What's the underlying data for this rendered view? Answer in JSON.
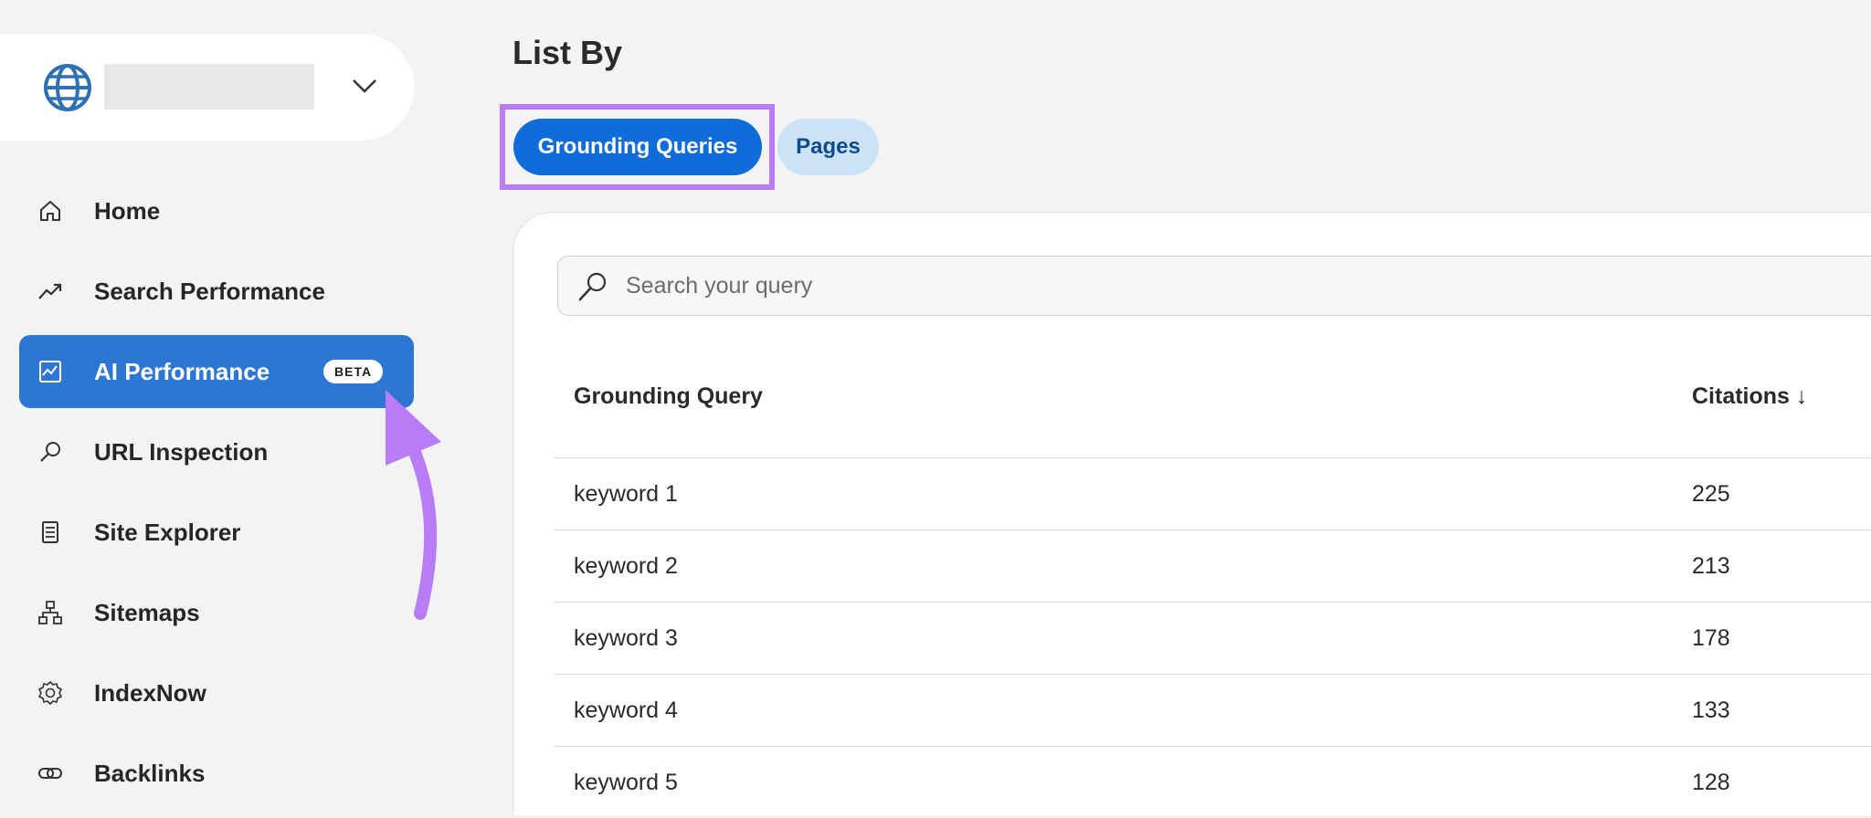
{
  "sidebar": {
    "nav_items": [
      {
        "label": "Home",
        "icon": "home-icon"
      },
      {
        "label": "Search Performance",
        "icon": "trending-up-icon"
      },
      {
        "label": "AI Performance",
        "icon": "chart-icon",
        "badge": "BETA",
        "active": true
      },
      {
        "label": "URL Inspection",
        "icon": "search-icon"
      },
      {
        "label": "Site Explorer",
        "icon": "document-list-icon"
      },
      {
        "label": "Sitemaps",
        "icon": "sitemap-icon"
      },
      {
        "label": "IndexNow",
        "icon": "settings-gear-icon"
      },
      {
        "label": "Backlinks",
        "icon": "link-icon"
      }
    ]
  },
  "main": {
    "title": "List By",
    "tabs": [
      {
        "label": "Grounding Queries",
        "active": true
      },
      {
        "label": "Pages",
        "active": false
      }
    ],
    "search": {
      "placeholder": "Search your query",
      "value": ""
    },
    "table": {
      "columns": [
        "Grounding Query",
        "Citations ↓"
      ],
      "rows": [
        [
          "keyword 1",
          "225"
        ],
        [
          "keyword 2",
          "213"
        ],
        [
          "keyword 3",
          "178"
        ],
        [
          "keyword 4",
          "133"
        ],
        [
          "keyword 5",
          "128"
        ]
      ]
    }
  },
  "colors": {
    "accent": "#0f6cd8",
    "active_nav": "#2e76d3",
    "highlight": "#b77cf6",
    "background": "#f3f3f3"
  }
}
